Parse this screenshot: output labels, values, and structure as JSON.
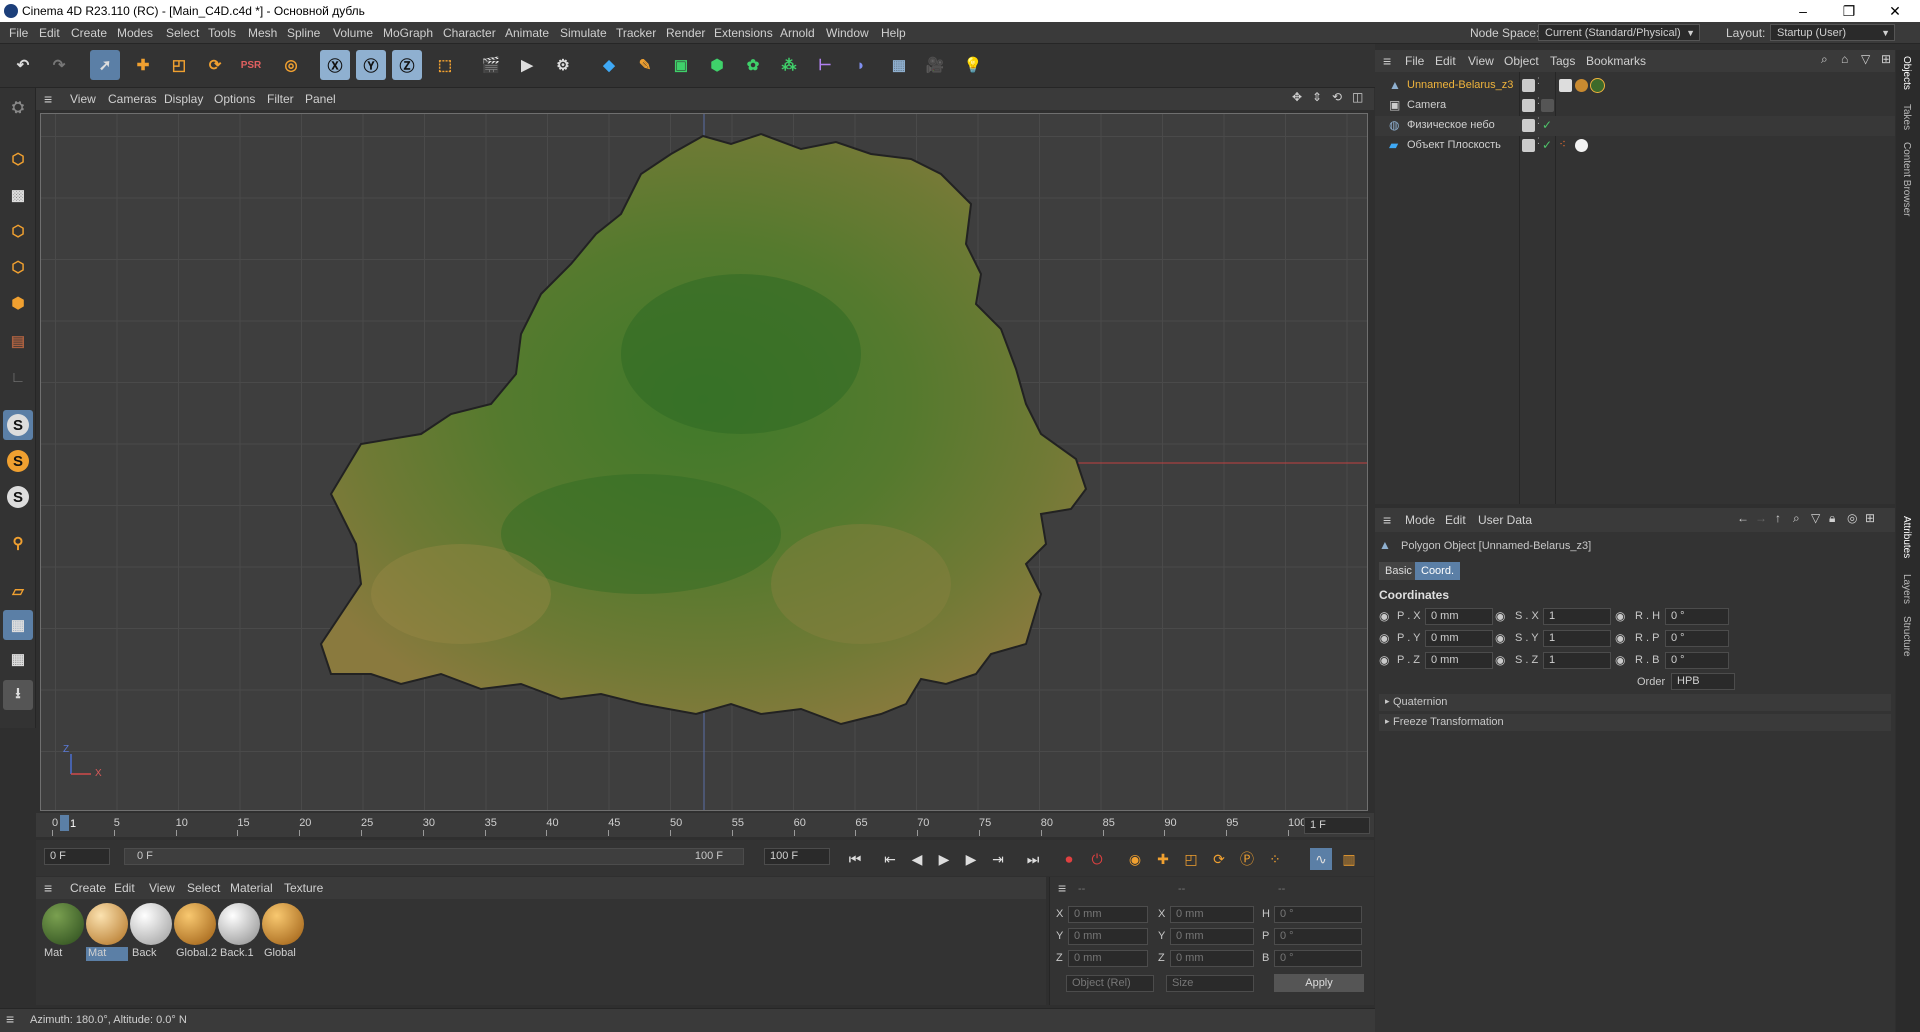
{
  "window": {
    "title": "Cinema 4D R23.110 (RC) - [Main_C4D.c4d *] - Основной дубль",
    "controls": [
      "–",
      "❐",
      "✕"
    ]
  },
  "menubar": {
    "items": [
      "File",
      "Edit",
      "Create",
      "Modes",
      "Select",
      "Tools",
      "Mesh",
      "Spline",
      "Volume",
      "MoGraph",
      "Character",
      "Animate",
      "Simulate",
      "Tracker",
      "Render",
      "Extensions",
      "Arnold",
      "Window",
      "Help"
    ],
    "node_space_label": "Node Space:",
    "node_space_value": "Current (Standard/Physical)",
    "layout_label": "Layout:",
    "layout_value": "Startup (User)"
  },
  "viewport": {
    "menu": [
      "View",
      "Cameras",
      "Display",
      "Options",
      "Filter",
      "Panel"
    ],
    "axis_z": "Z",
    "axis_x": "X"
  },
  "timeline": {
    "ticks": [
      "0",
      "5",
      "10",
      "15",
      "20",
      "25",
      "30",
      "35",
      "40",
      "45",
      "50",
      "55",
      "60",
      "65",
      "70",
      "75",
      "80",
      "85",
      "90",
      "95",
      "100"
    ],
    "current_frame_label": "1",
    "frame_field": "1 F",
    "start_field": "0 F",
    "range_start": "0 F",
    "range_end": "100 F",
    "end_field": "100 F"
  },
  "material_manager": {
    "menu": [
      "Create",
      "Edit",
      "View",
      "Select",
      "Material",
      "Texture"
    ],
    "materials": [
      {
        "name": "Mat",
        "color": "#3d6a2a",
        "selected": false
      },
      {
        "name": "Mat",
        "color": "#d9a04a",
        "selected": true
      },
      {
        "name": "Back",
        "color": "#e8e8e8",
        "selected": false
      },
      {
        "name": "Global.2",
        "color": "#d68f25",
        "selected": false
      },
      {
        "name": "Back.1",
        "color": "#dadada",
        "selected": false
      },
      {
        "name": "Global",
        "color": "#d68f25",
        "selected": false
      }
    ]
  },
  "coord_manager": {
    "headers": [
      "--",
      "--",
      "--"
    ],
    "rows": [
      {
        "a": "X",
        "av": "0 mm",
        "b": "X",
        "bv": "0 mm",
        "c": "H",
        "cv": "0 °"
      },
      {
        "a": "Y",
        "av": "0 mm",
        "b": "Y",
        "bv": "0 mm",
        "c": "P",
        "cv": "0 °"
      },
      {
        "a": "Z",
        "av": "0 mm",
        "b": "Z",
        "bv": "0 mm",
        "c": "B",
        "cv": "0 °"
      }
    ],
    "mode_select": "Object (Rel)",
    "size_select": "Size",
    "apply_label": "Apply"
  },
  "statusbar": {
    "text": "Azimuth: 180.0°, Altitude: 0.0°  N"
  },
  "object_manager": {
    "menu": [
      "File",
      "Edit",
      "View",
      "Object",
      "Tags",
      "Bookmarks"
    ],
    "objects": [
      {
        "name": "Unnamed-Belarus_z3",
        "highlight": true
      },
      {
        "name": "Camera",
        "highlight": false
      },
      {
        "name": "Физическое небо",
        "highlight": false
      },
      {
        "name": "Объект Плоскость",
        "highlight": false
      }
    ]
  },
  "attribute_manager": {
    "menu": [
      "Mode",
      "Edit",
      "User Data"
    ],
    "object_title": "Polygon Object [Unnamed-Belarus_z3]",
    "tabs": [
      "Basic",
      "Coord."
    ],
    "section": "Coordinates",
    "rows": [
      {
        "p": "P . X",
        "pv": "0 mm",
        "s": "S . X",
        "sv": "1",
        "r": "R . H",
        "rv": "0 °"
      },
      {
        "p": "P . Y",
        "pv": "0 mm",
        "s": "S . Y",
        "sv": "1",
        "r": "R . P",
        "rv": "0 °"
      },
      {
        "p": "P . Z",
        "pv": "0 mm",
        "s": "S . Z",
        "sv": "1",
        "r": "R . B",
        "rv": "0 °"
      }
    ],
    "order_label": "Order",
    "order_value": "HPB",
    "collapsibles": [
      "Quaternion",
      "Freeze Transformation"
    ]
  },
  "side_tabs": {
    "top": [
      "Objects",
      "Takes",
      "Content Browser"
    ],
    "bottom": [
      "Attributes",
      "Layers",
      "Structure"
    ]
  },
  "colors": {
    "accent": "#5b7fa6",
    "highlight_text": "#f0b43c",
    "panel": "#333333"
  }
}
